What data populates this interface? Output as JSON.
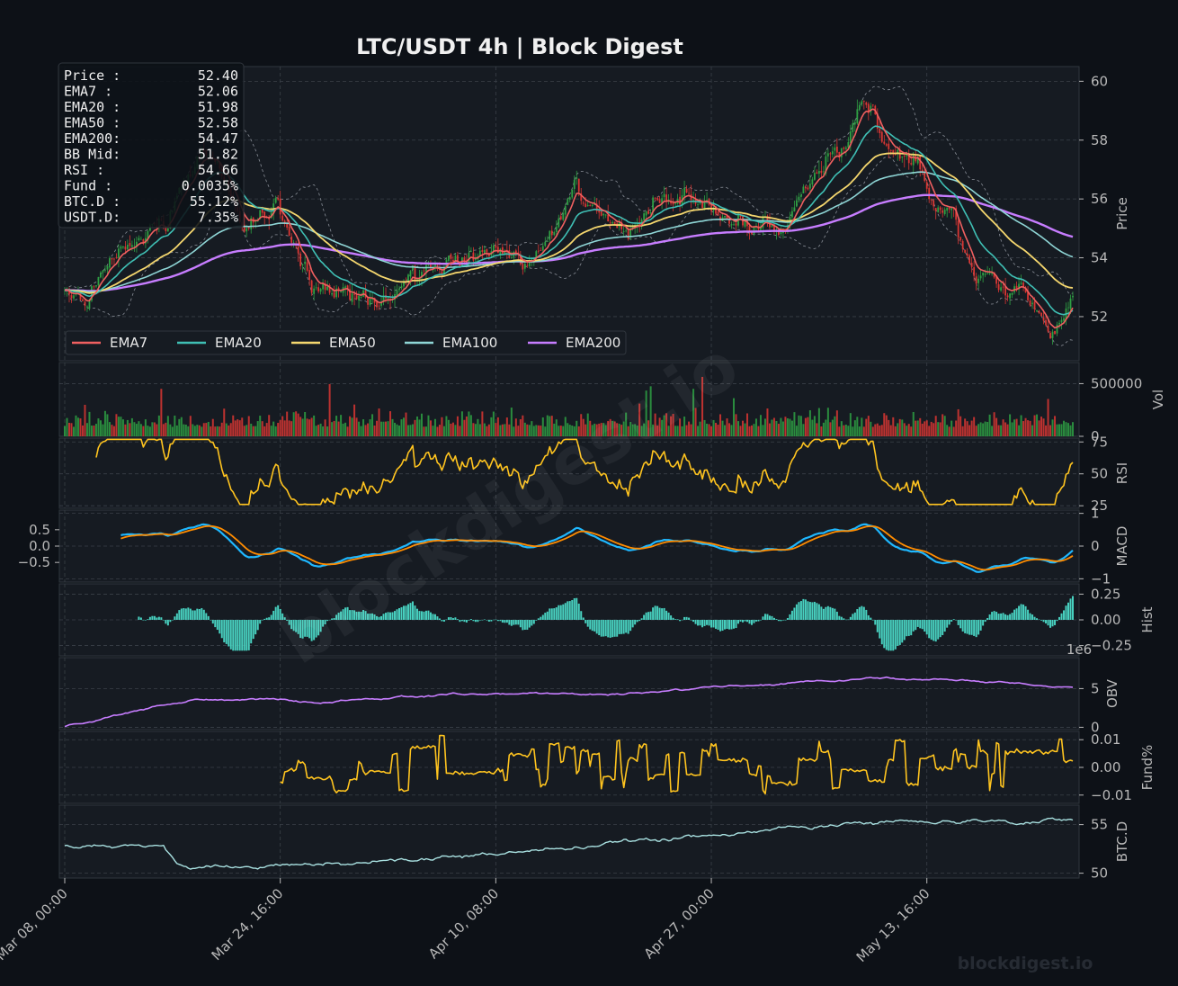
{
  "title": "LTC/USDT  4h  |  Block Digest",
  "watermark": "blockdigest.io",
  "footer": "blockdigest.io",
  "colors": {
    "background": "#0d1117",
    "panel": "#161b22",
    "grid": "#3a4048",
    "candle_up": "#2ea043",
    "candle_down": "#da3633",
    "ema7": "#f06060",
    "ema20": "#3fbfb4",
    "ema50": "#f5d76e",
    "ema100": "#8fd6d6",
    "ema200": "#c77dff",
    "bollinger": "#8a8f98",
    "rsi": "#ffc41f",
    "macd": "#1fb8ff",
    "signal": "#ff8c00",
    "hist": "#48d1c0",
    "obv": "#c77dff",
    "funding": "#ffc41f",
    "btc_dominance": "#a8e0e0"
  },
  "info_box": [
    {
      "label": "Price :",
      "value": "52.40"
    },
    {
      "label": "EMA7  :",
      "value": "52.06"
    },
    {
      "label": "EMA20 :",
      "value": "51.98"
    },
    {
      "label": "EMA50 :",
      "value": "52.58"
    },
    {
      "label": "EMA200:",
      "value": "54.47"
    },
    {
      "label": "BB Mid:",
      "value": "51.82"
    },
    {
      "label": "RSI   :",
      "value": "54.66"
    },
    {
      "label": "Fund  :",
      "value": "0.0035%"
    },
    {
      "label": "BTC.D :",
      "value": "55.12%"
    },
    {
      "label": "USDT.D:",
      "value": "7.35%"
    }
  ],
  "legend": [
    "EMA7",
    "EMA20",
    "EMA50",
    "EMA100",
    "EMA200"
  ],
  "chart_data": {
    "type": "line",
    "timeframe": "4h",
    "x_ticks": [
      "Mar 08, 00:00",
      "Mar 24, 16:00",
      "Apr 10, 08:00",
      "Apr 27, 00:00",
      "May 13, 16:00"
    ],
    "bar_count": 450,
    "panels": [
      {
        "name": "Price",
        "kind": "candlestick",
        "ylim": [
          50.5,
          60.5
        ],
        "ticks": [
          "52",
          "54",
          "56",
          "58",
          "60"
        ],
        "anchors": [
          [
            0,
            53.0
          ],
          [
            10,
            52.6
          ],
          [
            25,
            54.5
          ],
          [
            45,
            55.0
          ],
          [
            55,
            56.8
          ],
          [
            62,
            57.8
          ],
          [
            70,
            57.0
          ],
          [
            80,
            55.0
          ],
          [
            95,
            55.8
          ],
          [
            110,
            53.0
          ],
          [
            125,
            53.0
          ],
          [
            138,
            52.2
          ],
          [
            150,
            52.8
          ],
          [
            160,
            53.5
          ],
          [
            175,
            53.8
          ],
          [
            190,
            54.2
          ],
          [
            205,
            54.0
          ],
          [
            215,
            54.5
          ],
          [
            228,
            56.5
          ],
          [
            240,
            55.5
          ],
          [
            250,
            54.8
          ],
          [
            262,
            55.8
          ],
          [
            275,
            56.0
          ],
          [
            290,
            55.5
          ],
          [
            305,
            55.3
          ],
          [
            320,
            55.2
          ],
          [
            330,
            56.5
          ],
          [
            340,
            57.5
          ],
          [
            350,
            58.0
          ],
          [
            355,
            59.5
          ],
          [
            362,
            58.5
          ],
          [
            370,
            57.5
          ],
          [
            380,
            57.5
          ],
          [
            385,
            56.0
          ],
          [
            395,
            55.5
          ],
          [
            405,
            53.5
          ],
          [
            415,
            53.0
          ],
          [
            425,
            53.0
          ],
          [
            435,
            51.8
          ],
          [
            440,
            51.5
          ],
          [
            445,
            51.8
          ],
          [
            449,
            52.4
          ]
        ]
      },
      {
        "name": "Vol",
        "kind": "volume",
        "ylim": [
          0,
          700000
        ],
        "ticks": [
          "0",
          "500000"
        ]
      },
      {
        "name": "RSI",
        "kind": "line",
        "ylim": [
          23,
          78
        ],
        "ticks": [
          "25",
          "50",
          "75"
        ]
      },
      {
        "name": "MACD",
        "kind": "line",
        "ylim": [
          -1.1,
          1.1
        ],
        "ticks": [
          "−1",
          "0",
          "1"
        ],
        "left_ticks": [
          "0.5",
          "0.0",
          "−0.5"
        ]
      },
      {
        "name": "Hist",
        "kind": "bar",
        "ylim": [
          -0.35,
          0.35
        ],
        "ticks": [
          "−0.25",
          "0.00",
          "0.25"
        ],
        "offset_label": "1e6"
      },
      {
        "name": "OBV",
        "kind": "line",
        "ylim": [
          -0.3,
          9.0
        ],
        "ticks": [
          "0",
          "5"
        ]
      },
      {
        "name": "Fund%",
        "kind": "line",
        "ylim": [
          -0.013,
          0.013
        ],
        "ticks": [
          "−0.01",
          "0.00",
          "0.01"
        ]
      },
      {
        "name": "BTC.D",
        "kind": "line",
        "ylim": [
          49.5,
          57.0
        ],
        "ticks": [
          "50",
          "55"
        ]
      }
    ]
  }
}
